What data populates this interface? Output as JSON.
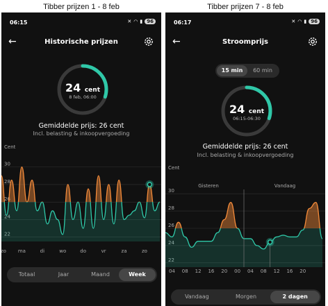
{
  "captions": {
    "left": "Tibber prijzen 1 - 8 feb",
    "right": "Tibber prijzen 7 - 8 feb"
  },
  "colors": {
    "accent": "#2fc8a8",
    "orange": "#f28a3a",
    "background": "#111111"
  },
  "phone1": {
    "status": {
      "time": "06:15",
      "battery": "96"
    },
    "title": "Historische prijzen",
    "ring": {
      "value_num": "24",
      "value_unit": "cent",
      "subtitle": "8 feb, 06:00",
      "fill_fraction": 0.3
    },
    "average": "Gemiddelde prijs: 26 cent",
    "incl": "Incl. belasting & inkoopvergoeding",
    "unit_label": "Cent",
    "yticks": [
      "30",
      "28",
      "26",
      "24",
      "22"
    ],
    "xticks": [
      "zo",
      "ma",
      "di",
      "wo",
      "do",
      "vr",
      "za",
      "zo"
    ],
    "tabs": [
      "Totaal",
      "Jaar",
      "Maand",
      "Week"
    ],
    "active_tab": "Week"
  },
  "phone2": {
    "status": {
      "time": "06:17",
      "battery": "96"
    },
    "title": "Stroomprijs",
    "toggle": [
      "15 min",
      "60 min"
    ],
    "active_toggle": "15 min",
    "ring": {
      "value_num": "24",
      "value_unit": "cent",
      "subtitle": "06:15-06:30",
      "fill_fraction": 0.3
    },
    "average": "Gemiddelde prijs: 26 cent",
    "incl": "Incl. belasting & inkoopvergoeding",
    "unit_label": "Cent",
    "day_labels": [
      "Gisteren",
      "Vandaag"
    ],
    "yticks": [
      "30",
      "28",
      "26",
      "24",
      "22"
    ],
    "xticks": [
      "04",
      "08",
      "12",
      "16",
      "20",
      "00",
      "04",
      "08",
      "12",
      "16",
      "20"
    ],
    "tabs": [
      "Vandaag",
      "Morgen",
      "2 dagen"
    ],
    "active_tab": "2 dagen"
  },
  "chart_data": [
    {
      "type": "line",
      "title": "",
      "ylabel": "Cent",
      "ylim": [
        21.5,
        31
      ],
      "xticks": [
        "zo",
        "ma",
        "di",
        "wo",
        "do",
        "vr",
        "za",
        "zo"
      ],
      "x": [
        0,
        0.25,
        0.5,
        0.75,
        1,
        1.25,
        1.5,
        1.75,
        2,
        2.25,
        2.5,
        2.75,
        3,
        3.25,
        3.5,
        3.75,
        4,
        4.25,
        4.5,
        4.75,
        5,
        5.25,
        5.5,
        5.75,
        6,
        6.25,
        6.5,
        6.75,
        7,
        7.25,
        7.5,
        7.75
      ],
      "values": [
        29,
        24.5,
        28.5,
        25,
        30,
        26,
        28.5,
        25,
        26,
        23.5,
        25,
        24,
        22.3,
        28,
        24,
        26,
        23,
        27.5,
        23,
        29,
        24,
        28,
        23.5,
        28.5,
        24,
        24.5,
        25,
        26,
        24.2,
        28,
        25,
        26
      ],
      "color_above_26": "#f28a3a",
      "color_below_26": "#2fc8a8"
    },
    {
      "type": "line",
      "title": "",
      "ylabel": "Cent",
      "ylim": [
        21.5,
        30.5
      ],
      "xticks": [
        "04",
        "08",
        "12",
        "16",
        "20",
        "00",
        "04",
        "08",
        "12",
        "16",
        "20"
      ],
      "x": [
        0,
        2,
        4,
        6,
        8,
        10,
        12,
        14,
        16,
        18,
        20,
        22,
        24,
        26,
        28,
        30,
        32,
        34,
        36,
        38,
        40,
        42,
        44,
        46,
        48
      ],
      "values": [
        25.5,
        25,
        26.7,
        25,
        23.8,
        24.5,
        24.5,
        24.5,
        25.5,
        27,
        29,
        26,
        24.8,
        24.8,
        24,
        23.6,
        24.4,
        25,
        25.2,
        25,
        25,
        25.8,
        28.3,
        29,
        24.8
      ],
      "color_above_26": "#f28a3a",
      "color_below_26": "#2fc8a8"
    }
  ]
}
